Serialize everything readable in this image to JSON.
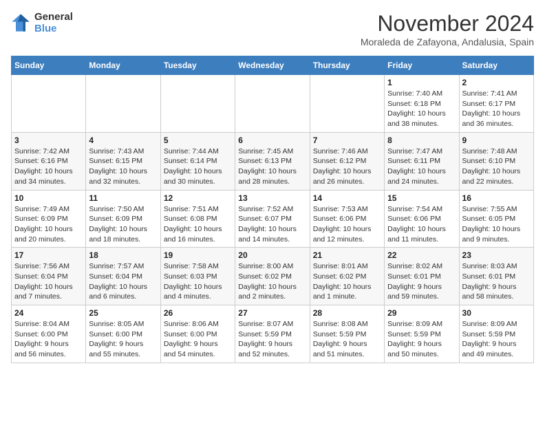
{
  "header": {
    "logo_line1": "General",
    "logo_line2": "Blue",
    "month_title": "November 2024",
    "location": "Moraleda de Zafayona, Andalusia, Spain"
  },
  "weekdays": [
    "Sunday",
    "Monday",
    "Tuesday",
    "Wednesday",
    "Thursday",
    "Friday",
    "Saturday"
  ],
  "weeks": [
    [
      {
        "day": "",
        "info": ""
      },
      {
        "day": "",
        "info": ""
      },
      {
        "day": "",
        "info": ""
      },
      {
        "day": "",
        "info": ""
      },
      {
        "day": "",
        "info": ""
      },
      {
        "day": "1",
        "info": "Sunrise: 7:40 AM\nSunset: 6:18 PM\nDaylight: 10 hours\nand 38 minutes."
      },
      {
        "day": "2",
        "info": "Sunrise: 7:41 AM\nSunset: 6:17 PM\nDaylight: 10 hours\nand 36 minutes."
      }
    ],
    [
      {
        "day": "3",
        "info": "Sunrise: 7:42 AM\nSunset: 6:16 PM\nDaylight: 10 hours\nand 34 minutes."
      },
      {
        "day": "4",
        "info": "Sunrise: 7:43 AM\nSunset: 6:15 PM\nDaylight: 10 hours\nand 32 minutes."
      },
      {
        "day": "5",
        "info": "Sunrise: 7:44 AM\nSunset: 6:14 PM\nDaylight: 10 hours\nand 30 minutes."
      },
      {
        "day": "6",
        "info": "Sunrise: 7:45 AM\nSunset: 6:13 PM\nDaylight: 10 hours\nand 28 minutes."
      },
      {
        "day": "7",
        "info": "Sunrise: 7:46 AM\nSunset: 6:12 PM\nDaylight: 10 hours\nand 26 minutes."
      },
      {
        "day": "8",
        "info": "Sunrise: 7:47 AM\nSunset: 6:11 PM\nDaylight: 10 hours\nand 24 minutes."
      },
      {
        "day": "9",
        "info": "Sunrise: 7:48 AM\nSunset: 6:10 PM\nDaylight: 10 hours\nand 22 minutes."
      }
    ],
    [
      {
        "day": "10",
        "info": "Sunrise: 7:49 AM\nSunset: 6:09 PM\nDaylight: 10 hours\nand 20 minutes."
      },
      {
        "day": "11",
        "info": "Sunrise: 7:50 AM\nSunset: 6:09 PM\nDaylight: 10 hours\nand 18 minutes."
      },
      {
        "day": "12",
        "info": "Sunrise: 7:51 AM\nSunset: 6:08 PM\nDaylight: 10 hours\nand 16 minutes."
      },
      {
        "day": "13",
        "info": "Sunrise: 7:52 AM\nSunset: 6:07 PM\nDaylight: 10 hours\nand 14 minutes."
      },
      {
        "day": "14",
        "info": "Sunrise: 7:53 AM\nSunset: 6:06 PM\nDaylight: 10 hours\nand 12 minutes."
      },
      {
        "day": "15",
        "info": "Sunrise: 7:54 AM\nSunset: 6:06 PM\nDaylight: 10 hours\nand 11 minutes."
      },
      {
        "day": "16",
        "info": "Sunrise: 7:55 AM\nSunset: 6:05 PM\nDaylight: 10 hours\nand 9 minutes."
      }
    ],
    [
      {
        "day": "17",
        "info": "Sunrise: 7:56 AM\nSunset: 6:04 PM\nDaylight: 10 hours\nand 7 minutes."
      },
      {
        "day": "18",
        "info": "Sunrise: 7:57 AM\nSunset: 6:04 PM\nDaylight: 10 hours\nand 6 minutes."
      },
      {
        "day": "19",
        "info": "Sunrise: 7:58 AM\nSunset: 6:03 PM\nDaylight: 10 hours\nand 4 minutes."
      },
      {
        "day": "20",
        "info": "Sunrise: 8:00 AM\nSunset: 6:02 PM\nDaylight: 10 hours\nand 2 minutes."
      },
      {
        "day": "21",
        "info": "Sunrise: 8:01 AM\nSunset: 6:02 PM\nDaylight: 10 hours\nand 1 minute."
      },
      {
        "day": "22",
        "info": "Sunrise: 8:02 AM\nSunset: 6:01 PM\nDaylight: 9 hours\nand 59 minutes."
      },
      {
        "day": "23",
        "info": "Sunrise: 8:03 AM\nSunset: 6:01 PM\nDaylight: 9 hours\nand 58 minutes."
      }
    ],
    [
      {
        "day": "24",
        "info": "Sunrise: 8:04 AM\nSunset: 6:00 PM\nDaylight: 9 hours\nand 56 minutes."
      },
      {
        "day": "25",
        "info": "Sunrise: 8:05 AM\nSunset: 6:00 PM\nDaylight: 9 hours\nand 55 minutes."
      },
      {
        "day": "26",
        "info": "Sunrise: 8:06 AM\nSunset: 6:00 PM\nDaylight: 9 hours\nand 54 minutes."
      },
      {
        "day": "27",
        "info": "Sunrise: 8:07 AM\nSunset: 5:59 PM\nDaylight: 9 hours\nand 52 minutes."
      },
      {
        "day": "28",
        "info": "Sunrise: 8:08 AM\nSunset: 5:59 PM\nDaylight: 9 hours\nand 51 minutes."
      },
      {
        "day": "29",
        "info": "Sunrise: 8:09 AM\nSunset: 5:59 PM\nDaylight: 9 hours\nand 50 minutes."
      },
      {
        "day": "30",
        "info": "Sunrise: 8:09 AM\nSunset: 5:59 PM\nDaylight: 9 hours\nand 49 minutes."
      }
    ]
  ]
}
